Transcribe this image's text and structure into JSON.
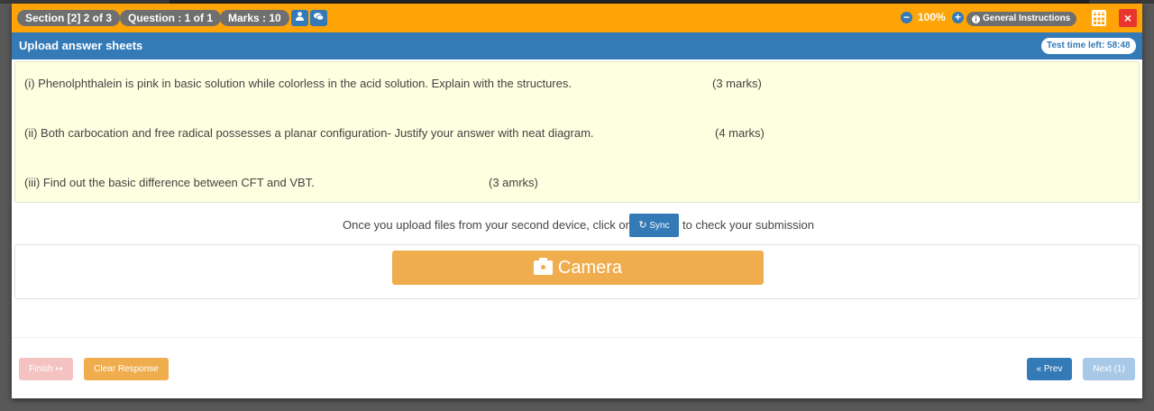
{
  "topbar": {
    "section": "Section [2] 2 of 3",
    "question": "Question : 1 of 1",
    "marks": "Marks : 10",
    "zoom_minus": "−",
    "zoom_value": "100%",
    "zoom_plus": "+",
    "general_instructions": "General Instructions",
    "close": "×",
    "accent_color": "#ffa406"
  },
  "header": {
    "title": "Upload answer sheets",
    "timer": "Test time left: 58:48",
    "color": "#337ab7"
  },
  "questions": [
    {
      "text": "(i) Phenolphthalein is pink in basic solution while colorless in the acid solution. Explain with the structures.",
      "marks": "(3 marks)"
    },
    {
      "text": "(ii) Both carbocation and free radical possesses a planar configuration- Justify your answer with neat diagram.",
      "marks": "(4 marks)"
    },
    {
      "text": "(iii) Find out the basic difference between CFT and VBT.",
      "marks": "(3 amrks)"
    }
  ],
  "sync": {
    "before": "Once you upload files from your second device, click on",
    "button": "Sync",
    "after": "to check your submission"
  },
  "camera": {
    "label": "Camera"
  },
  "footer": {
    "finish": "Finish",
    "clear_response": "Clear Response",
    "prev": "« Prev",
    "next": "Next (1)"
  }
}
